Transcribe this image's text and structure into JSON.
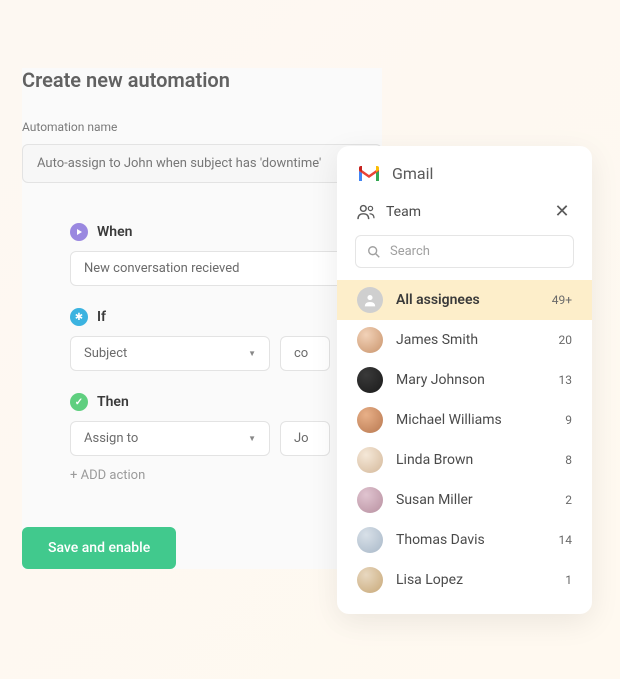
{
  "automation": {
    "title": "Create new automation",
    "name_label": "Automation name",
    "name_value": "Auto-assign to John when subject has 'downtime'",
    "when": {
      "label": "When",
      "value": "New conversation recieved"
    },
    "if": {
      "label": "If",
      "field": "Subject",
      "op": "co"
    },
    "then": {
      "label": "Then",
      "action": "Assign to",
      "target": "Jo"
    },
    "add_action": "+ ADD action",
    "save_label": "Save and enable"
  },
  "popover": {
    "app_name": "Gmail",
    "section_label": "Team",
    "search_placeholder": "Search",
    "all_label": "All assignees",
    "all_count": "49+",
    "members": [
      {
        "name": "James Smith",
        "count": "20"
      },
      {
        "name": "Mary Johnson",
        "count": "13"
      },
      {
        "name": "Michael Williams",
        "count": "9"
      },
      {
        "name": "Linda Brown",
        "count": "8"
      },
      {
        "name": "Susan Miller",
        "count": "2"
      },
      {
        "name": "Thomas Davis",
        "count": "14"
      },
      {
        "name": "Lisa Lopez",
        "count": "1"
      }
    ]
  }
}
